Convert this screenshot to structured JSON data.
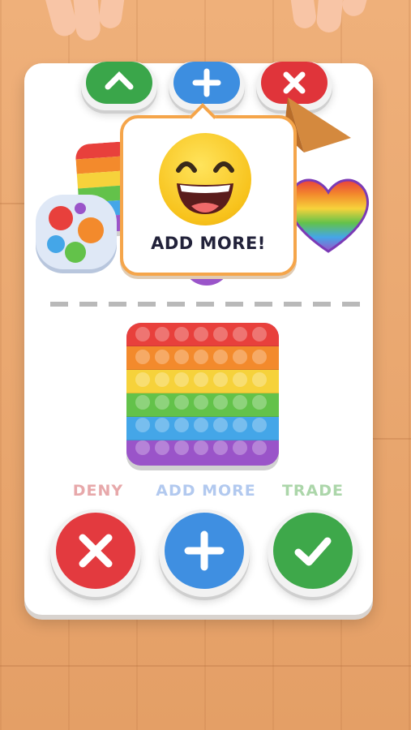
{
  "top_buttons": [
    {
      "name": "accept",
      "icon": "check-icon",
      "color": "#3aa64a"
    },
    {
      "name": "add",
      "icon": "plus-icon",
      "color": "#3d8ee0"
    },
    {
      "name": "deny",
      "icon": "x-icon",
      "color": "#e0343a"
    }
  ],
  "popup": {
    "emoji": "grinning-face-icon",
    "text": "ADD MORE!"
  },
  "bottom_labels": {
    "deny": "DENY",
    "add_more": "ADD MORE",
    "trade": "TRADE"
  },
  "bottom_buttons": [
    {
      "name": "deny",
      "icon": "x-icon",
      "color": "#e33a3f"
    },
    {
      "name": "add-more",
      "icon": "plus-icon",
      "color": "#3f8fe1"
    },
    {
      "name": "trade",
      "icon": "check-icon",
      "color": "#3ea84a"
    }
  ],
  "colors": {
    "deny_label": "#e7a8aa",
    "add_more_label": "#b2c9ef",
    "trade_label": "#acd6aa",
    "popup_border": "#f5a54a"
  }
}
